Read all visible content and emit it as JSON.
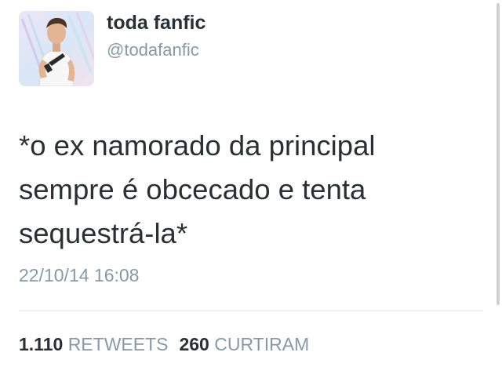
{
  "user": {
    "display_name": "toda fanfic",
    "handle": "@todafanfic",
    "avatar_icon": "profile-photo"
  },
  "tweet": {
    "lines": [
      "*o ex namorado da principal",
      "sempre é obcecado e tenta",
      "sequestrá-la*"
    ],
    "timestamp": "22/10/14 16:08"
  },
  "stats": {
    "retweets_count": "1.110",
    "retweets_label": "RETWEETS",
    "likes_count": "260",
    "likes_label": "CURTIRAM"
  },
  "colors": {
    "text": "#292f33",
    "secondary": "#8899a6",
    "divider": "#e1e8ed"
  }
}
